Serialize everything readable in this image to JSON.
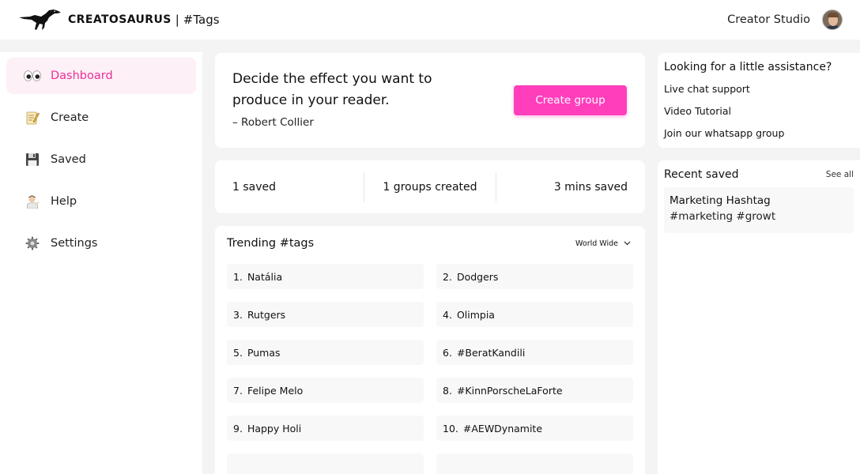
{
  "header": {
    "brand_name": "CREATOSAURUS",
    "brand_separator": "|",
    "brand_section": "#Tags",
    "studio_link": "Creator Studio"
  },
  "sidebar": {
    "items": [
      {
        "label": "Dashboard",
        "icon": "eyes-icon",
        "active": true
      },
      {
        "label": "Create",
        "icon": "memo-icon",
        "active": false
      },
      {
        "label": "Saved",
        "icon": "floppy-disk-icon",
        "active": false
      },
      {
        "label": "Help",
        "icon": "person-tipping-hand-icon",
        "active": false
      },
      {
        "label": "Settings",
        "icon": "gear-icon",
        "active": false
      }
    ]
  },
  "quote": {
    "text": "Decide the effect you want to produce in your reader.",
    "author": "– Robert Collier",
    "button_label": "Create group"
  },
  "stats": {
    "saved": "1  saved",
    "groups": "1  groups created",
    "mins": "3  mins saved"
  },
  "trending": {
    "title": "Trending #tags",
    "region": "World Wide",
    "tags": [
      {
        "num": "1.",
        "name": "Natália"
      },
      {
        "num": "2.",
        "name": "Dodgers"
      },
      {
        "num": "3.",
        "name": "Rutgers"
      },
      {
        "num": "4.",
        "name": "Olimpia"
      },
      {
        "num": "5.",
        "name": "Pumas"
      },
      {
        "num": "6.",
        "name": "#BeratKandili"
      },
      {
        "num": "7.",
        "name": "Felipe Melo"
      },
      {
        "num": "8.",
        "name": "#KinnPorscheLaForte"
      },
      {
        "num": "9.",
        "name": "Happy Holi"
      },
      {
        "num": "10.",
        "name": "#AEWDynamite"
      },
      {
        "num": "",
        "name": ""
      },
      {
        "num": "",
        "name": ""
      }
    ]
  },
  "help": {
    "title": "Looking for a little assistance?",
    "links": [
      "Live chat support",
      "Video Tutorial",
      "Join our whatsapp group"
    ]
  },
  "recent": {
    "title": "Recent saved",
    "see_all": "See all",
    "items": [
      {
        "title": "Marketing Hashtag",
        "tags": "#marketing #growt"
      }
    ]
  },
  "colors": {
    "accent": "#ff3ebc",
    "accent_text": "#ec2f97",
    "active_bg": "#fdf0f7"
  }
}
